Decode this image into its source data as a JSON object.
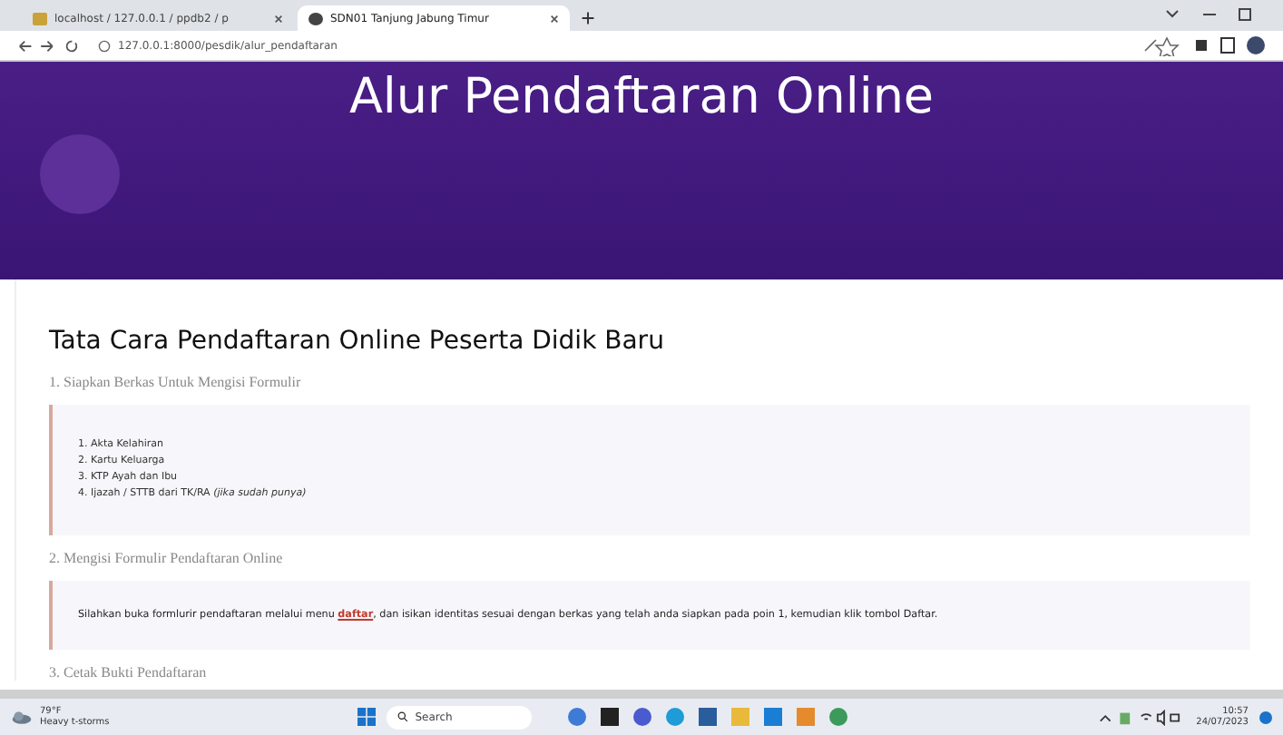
{
  "browser": {
    "tabs": [
      {
        "title": "localhost / 127.0.0.1 / ppdb2 / p",
        "selected": false
      },
      {
        "title": "SDN01 Tanjung Jabung Timur",
        "selected": true
      }
    ],
    "url": "127.0.0.1:8000/pesdik/alur_pendaftaran"
  },
  "hero": {
    "title": "Alur Pendaftaran Online"
  },
  "page": {
    "heading": "Tata Cara Pendaftaran Online Peserta Didik Baru",
    "steps": [
      {
        "kind": "list",
        "title": "1. Siapkan Berkas Untuk Mengisi Formulir",
        "items": [
          "1. Akta Kelahiran",
          "2. Kartu Keluarga",
          "3. KTP Ayah dan Ibu",
          "4. Ijazah / STTB dari TK/RA *(jika sudah punya)*"
        ]
      },
      {
        "kind": "text",
        "title": "2. Mengisi Formulir Pendaftaran Online",
        "before": "Silahkan buka formlurir pendaftaran melalui menu ",
        "link": "daftar",
        "after": ", dan isikan identitas sesuai dengan berkas yang telah anda siapkan pada poin 1, kemudian klik tombol Daftar."
      },
      {
        "kind": "heading",
        "title": "3. Cetak Bukti Pendaftaran"
      }
    ]
  },
  "taskbar": {
    "weather_temp": "79°F",
    "weather_text": "Heavy t-storms",
    "search_placeholder": "Search",
    "time": "10:57",
    "date": "24/07/2023"
  }
}
